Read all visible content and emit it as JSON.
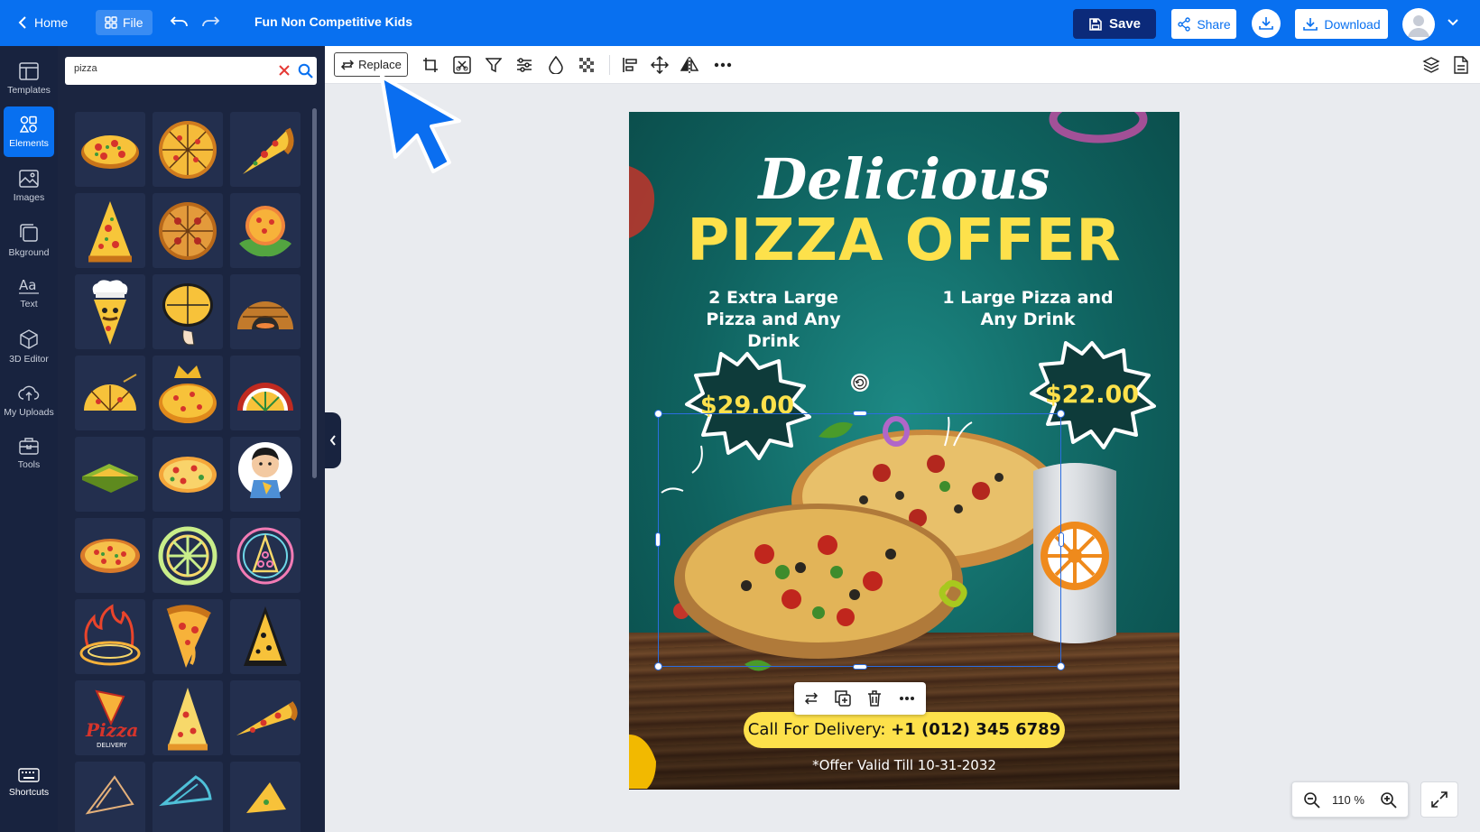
{
  "topbar": {
    "home_label": "Home",
    "file_label": "File",
    "document_title": "Fun Non Competitive Kids",
    "save_label": "Save",
    "share_label": "Share",
    "download_label": "Download",
    "accent_color": "#0870f0",
    "save_color": "#0b2a7a"
  },
  "sidebar": {
    "items": [
      {
        "label": "Templates",
        "icon": "templates-icon"
      },
      {
        "label": "Elements",
        "icon": "elements-icon",
        "active": true
      },
      {
        "label": "Images",
        "icon": "images-icon"
      },
      {
        "label": "Bkground",
        "icon": "background-icon"
      },
      {
        "label": "Text",
        "icon": "text-icon"
      },
      {
        "label": "3D Editor",
        "icon": "cube-icon"
      },
      {
        "label": "My Uploads",
        "icon": "upload-cloud-icon"
      },
      {
        "label": "Tools",
        "icon": "toolbox-icon"
      }
    ],
    "shortcuts_label": "Shortcuts"
  },
  "elements_panel": {
    "search_value": "pizza",
    "results": [
      "pizza-whole-icon",
      "pizza-sliced-icon",
      "pizza-slice-icon",
      "pizza-slice-icon",
      "pizza-sliced-icon",
      "pizza-leaves-icon",
      "pizza-chef-icon",
      "pizza-hand-icon",
      "pizza-oven-icon",
      "pizza-half-icon",
      "pizza-crown-icon",
      "pizza-half-icon",
      "pizza-box-icon",
      "pizza-whole-icon",
      "pizza-kid-icon",
      "pizza-whole-icon",
      "pizza-neon-icon",
      "pizza-neon-icon",
      "pizza-fire-icon",
      "pizza-slice-icon",
      "pizza-slice-icon",
      "pizza-logo-icon",
      "pizza-slice-icon",
      "pizza-slice-icon",
      "pizza-slice-icon",
      "pizza-slice-icon",
      "pizza-slice-icon"
    ]
  },
  "toolbar": {
    "replace_label": "Replace",
    "tools": [
      "crop-icon",
      "cutout-icon",
      "filter-icon",
      "adjust-icon",
      "opacity-icon",
      "transparency-icon",
      "align-icon",
      "move-icon",
      "flip-icon",
      "more-icon"
    ],
    "right_tools": [
      "layers-icon",
      "page-icon"
    ]
  },
  "poster": {
    "headline": "Delicious",
    "title": "PIZZA OFFER",
    "deal_left": "2 Extra Large Pizza and Any Drink",
    "deal_right": "1 Large Pizza and Any Drink",
    "price_left": "$29.00",
    "price_right": "$22.00",
    "call_label": "Call For Delivery:",
    "phone": "+1 (012) 345 6789",
    "validity": "*Offer Valid Till 10-31-2032",
    "colors": {
      "title": "#fde14b",
      "background": "#0f625f"
    }
  },
  "context_menu": {
    "items": [
      "replace-icon",
      "duplicate-icon",
      "trash-icon",
      "more-icon"
    ]
  },
  "zoom": {
    "level": "110 %"
  }
}
